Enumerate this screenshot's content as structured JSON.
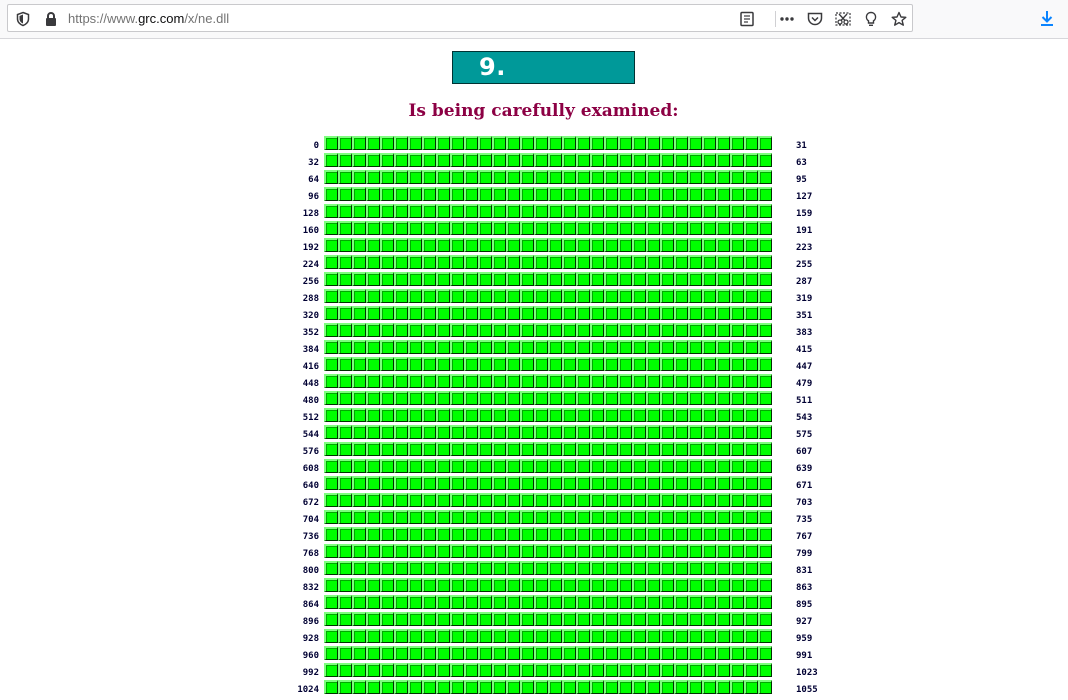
{
  "browser": {
    "url_prefix": "https://www.",
    "url_host": "grc.com",
    "url_path": "/x/ne.dll",
    "icons": [
      "shield-icon",
      "lock-icon",
      "reader-view-icon",
      "more-actions-icon",
      "pocket-icon",
      "screenshot-icon",
      "tips-icon",
      "bookmark-star-icon",
      "download-icon"
    ]
  },
  "page": {
    "banner_text": "9.",
    "heading": "Is being carefully examined:",
    "cells_per_row": 32,
    "rows": [
      {
        "left": "0",
        "right": "31"
      },
      {
        "left": "32",
        "right": "63"
      },
      {
        "left": "64",
        "right": "95"
      },
      {
        "left": "96",
        "right": "127"
      },
      {
        "left": "128",
        "right": "159"
      },
      {
        "left": "160",
        "right": "191"
      },
      {
        "left": "192",
        "right": "223"
      },
      {
        "left": "224",
        "right": "255"
      },
      {
        "left": "256",
        "right": "287"
      },
      {
        "left": "288",
        "right": "319"
      },
      {
        "left": "320",
        "right": "351"
      },
      {
        "left": "352",
        "right": "383"
      },
      {
        "left": "384",
        "right": "415"
      },
      {
        "left": "416",
        "right": "447"
      },
      {
        "left": "448",
        "right": "479"
      },
      {
        "left": "480",
        "right": "511"
      },
      {
        "left": "512",
        "right": "543"
      },
      {
        "left": "544",
        "right": "575"
      },
      {
        "left": "576",
        "right": "607"
      },
      {
        "left": "608",
        "right": "639"
      },
      {
        "left": "640",
        "right": "671"
      },
      {
        "left": "672",
        "right": "703"
      },
      {
        "left": "704",
        "right": "735"
      },
      {
        "left": "736",
        "right": "767"
      },
      {
        "left": "768",
        "right": "799"
      },
      {
        "left": "800",
        "right": "831"
      },
      {
        "left": "832",
        "right": "863"
      },
      {
        "left": "864",
        "right": "895"
      },
      {
        "left": "896",
        "right": "927"
      },
      {
        "left": "928",
        "right": "959"
      },
      {
        "left": "960",
        "right": "991"
      },
      {
        "left": "992",
        "right": "1023"
      },
      {
        "left": "1024",
        "right": "1055"
      }
    ]
  },
  "colors": {
    "banner_bg": "#009999",
    "heading": "#8c0044",
    "cell_fill": "#00ff00",
    "label": "#000033"
  }
}
